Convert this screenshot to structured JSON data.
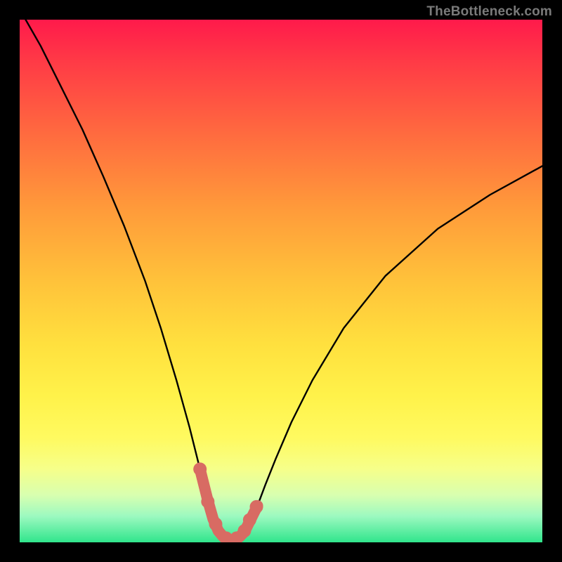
{
  "attribution": "TheBottleneck.com",
  "chart_data": {
    "type": "line",
    "title": "",
    "xlabel": "",
    "ylabel": "",
    "xlim": [
      0,
      100
    ],
    "ylim": [
      0,
      100
    ],
    "series": [
      {
        "name": "bottleneck-curve",
        "x": [
          0,
          4,
          8,
          12,
          16,
          20,
          24,
          27,
          30,
          32.5,
          34.5,
          36,
          37,
          38,
          39,
          40,
          41,
          42,
          43,
          44,
          45.5,
          47,
          49,
          52,
          56,
          62,
          70,
          80,
          90,
          100
        ],
        "y": [
          102,
          95,
          87,
          79,
          70,
          60.5,
          50,
          41,
          31,
          22,
          14,
          8,
          4.5,
          2.2,
          1,
          0.5,
          0.5,
          1,
          2,
          4,
          7,
          11,
          16,
          23,
          31,
          41,
          51,
          60,
          66.5,
          72
        ],
        "color": "#000000"
      },
      {
        "name": "low-bottleneck-band",
        "x": [
          34.5,
          36,
          37,
          38,
          39,
          40,
          41,
          42,
          43,
          44,
          45.5
        ],
        "y": [
          14,
          8,
          4.5,
          2.2,
          1,
          0.5,
          0.5,
          1,
          2,
          4,
          7
        ],
        "color": "#d86b63"
      }
    ],
    "dots": {
      "name": "low-bottleneck-dots",
      "x": [
        34.5,
        36,
        37.5,
        39.5,
        41.5,
        43,
        44,
        45.3
      ],
      "y": [
        14,
        7.8,
        3.5,
        0.8,
        0.8,
        2.2,
        4.3,
        6.8
      ],
      "color": "#d86b63"
    }
  }
}
